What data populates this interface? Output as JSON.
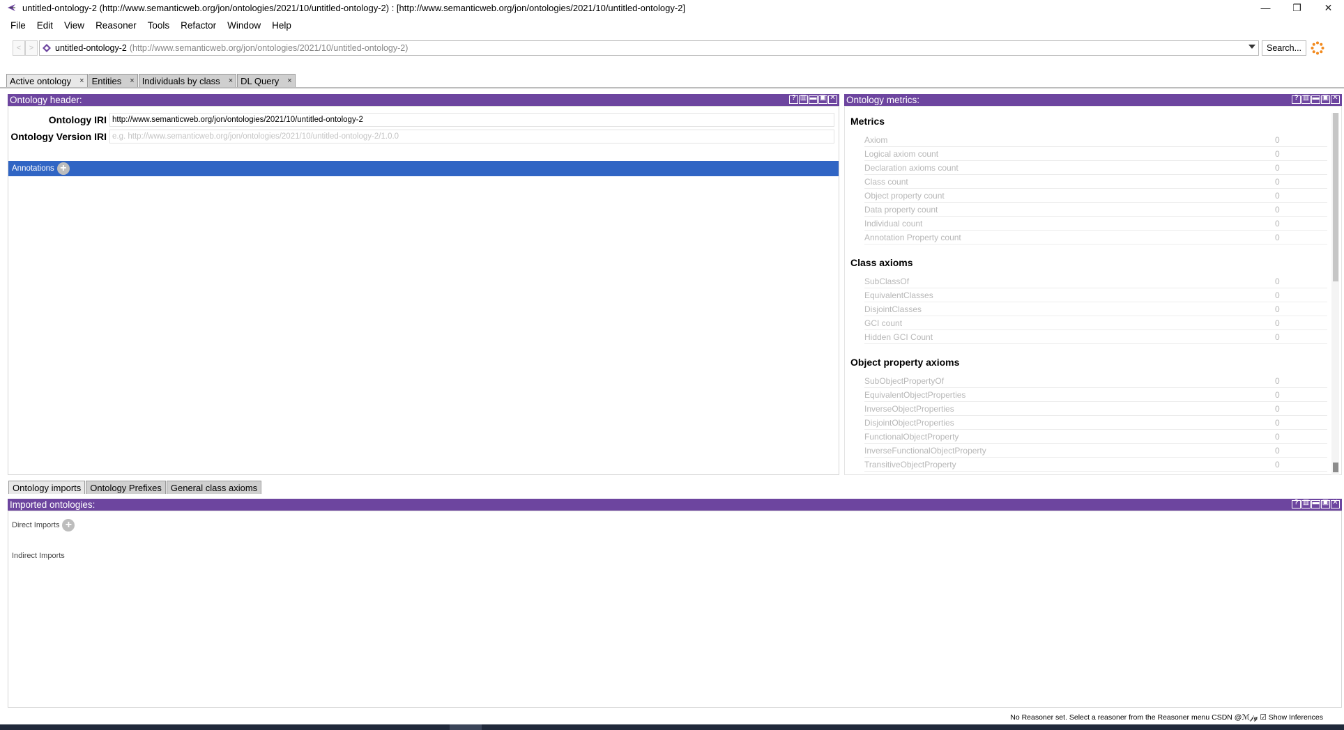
{
  "window": {
    "title": "untitled-ontology-2 (http://www.semanticweb.org/jon/ontologies/2021/10/untitled-ontology-2)  : [http://www.semanticweb.org/jon/ontologies/2021/10/untitled-ontology-2]",
    "minimize": "—",
    "restore": "❐",
    "close": "✕"
  },
  "menu": [
    "File",
    "Edit",
    "View",
    "Reasoner",
    "Tools",
    "Refactor",
    "Window",
    "Help"
  ],
  "address": {
    "back": "<",
    "forward": ">",
    "ontology_name": "untitled-ontology-2",
    "ontology_iri": "(http://www.semanticweb.org/jon/ontologies/2021/10/untitled-ontology-2)",
    "search_label": "Search..."
  },
  "tabs": [
    {
      "label": "Active ontology",
      "close": "×"
    },
    {
      "label": "Entities",
      "close": "×"
    },
    {
      "label": "Individuals by class",
      "close": "×"
    },
    {
      "label": "DL Query",
      "close": "×"
    }
  ],
  "header_view": {
    "title": "Ontology header:",
    "iri_label": "Ontology IRI",
    "iri_value": "http://www.semanticweb.org/jon/ontologies/2021/10/untitled-ontology-2",
    "version_label": "Ontology Version IRI",
    "version_placeholder": "e.g. http://www.semanticweb.org/jon/ontologies/2021/10/untitled-ontology-2/1.0.0",
    "annotations_label": "Annotations",
    "add_symbol": "+"
  },
  "view_buttons": [
    "?",
    "▥",
    "▬",
    "▣",
    "✕"
  ],
  "metrics_view": {
    "title": "Ontology metrics:",
    "sections": [
      {
        "heading": "Metrics",
        "rows": [
          {
            "label": "Axiom",
            "value": "0"
          },
          {
            "label": "Logical axiom count",
            "value": "0"
          },
          {
            "label": "Declaration axioms count",
            "value": "0"
          },
          {
            "label": "Class count",
            "value": "0"
          },
          {
            "label": "Object property count",
            "value": "0"
          },
          {
            "label": "Data property count",
            "value": "0"
          },
          {
            "label": "Individual count",
            "value": "0"
          },
          {
            "label": "Annotation Property count",
            "value": "0"
          }
        ]
      },
      {
        "heading": "Class axioms",
        "rows": [
          {
            "label": "SubClassOf",
            "value": "0"
          },
          {
            "label": "EquivalentClasses",
            "value": "0"
          },
          {
            "label": "DisjointClasses",
            "value": "0"
          },
          {
            "label": "GCI count",
            "value": "0"
          },
          {
            "label": "Hidden GCI Count",
            "value": "0"
          }
        ]
      },
      {
        "heading": "Object property axioms",
        "rows": [
          {
            "label": "SubObjectPropertyOf",
            "value": "0"
          },
          {
            "label": "EquivalentObjectProperties",
            "value": "0"
          },
          {
            "label": "InverseObjectProperties",
            "value": "0"
          },
          {
            "label": "DisjointObjectProperties",
            "value": "0"
          },
          {
            "label": "FunctionalObjectProperty",
            "value": "0"
          },
          {
            "label": "InverseFunctionalObjectProperty",
            "value": "0"
          },
          {
            "label": "TransitiveObjectProperty",
            "value": "0"
          }
        ]
      }
    ]
  },
  "bottom_tabs": [
    "Ontology imports",
    "Ontology Prefixes",
    "General class axioms"
  ],
  "imports_view": {
    "title": "Imported ontologies:",
    "direct": "Direct Imports",
    "indirect": "Indirect Imports",
    "add_symbol": "+"
  },
  "status": {
    "text": "No Reasoner set. Select a reasoner from the Reasoner menu  CSDN @ℳ𝒿𝓎 ☑ Show Inferences"
  }
}
